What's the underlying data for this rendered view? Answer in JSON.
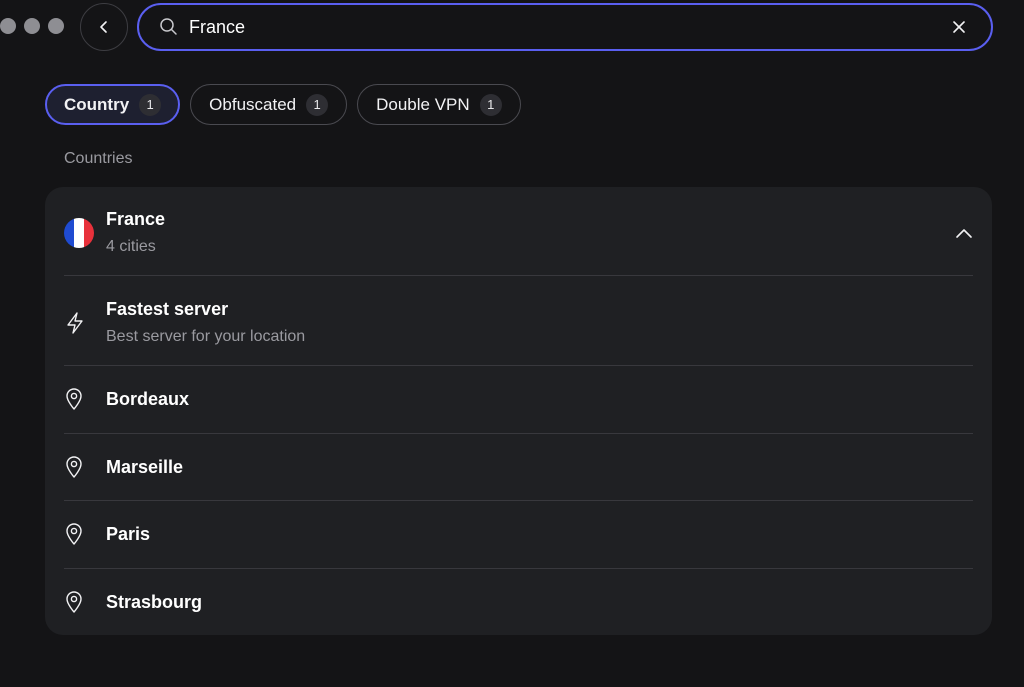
{
  "window": {
    "dots": [
      "close",
      "minimize",
      "maximize"
    ]
  },
  "back_button": {
    "icon": "chevron-left-icon"
  },
  "search": {
    "value": "France",
    "placeholder": "",
    "accent": "#5a5ff0"
  },
  "filters": [
    {
      "label": "Country",
      "count": "1",
      "active": true
    },
    {
      "label": "Obfuscated",
      "count": "1",
      "active": false
    },
    {
      "label": "Double VPN",
      "count": "1",
      "active": false
    }
  ],
  "section_label": "Countries",
  "country": {
    "name": "France",
    "subtitle": "4 cities",
    "flag_colors": [
      "#1f4bd1",
      "#ffffff",
      "#e8313b"
    ],
    "expanded": true
  },
  "items": [
    {
      "title": "Fastest server",
      "subtitle": "Best server for your location",
      "icon": "lightning-icon"
    },
    {
      "title": "Bordeaux",
      "icon": "location-pin-icon"
    },
    {
      "title": "Marseille",
      "icon": "location-pin-icon"
    },
    {
      "title": "Paris",
      "icon": "location-pin-icon"
    },
    {
      "title": "Strasbourg",
      "icon": "location-pin-icon"
    }
  ]
}
